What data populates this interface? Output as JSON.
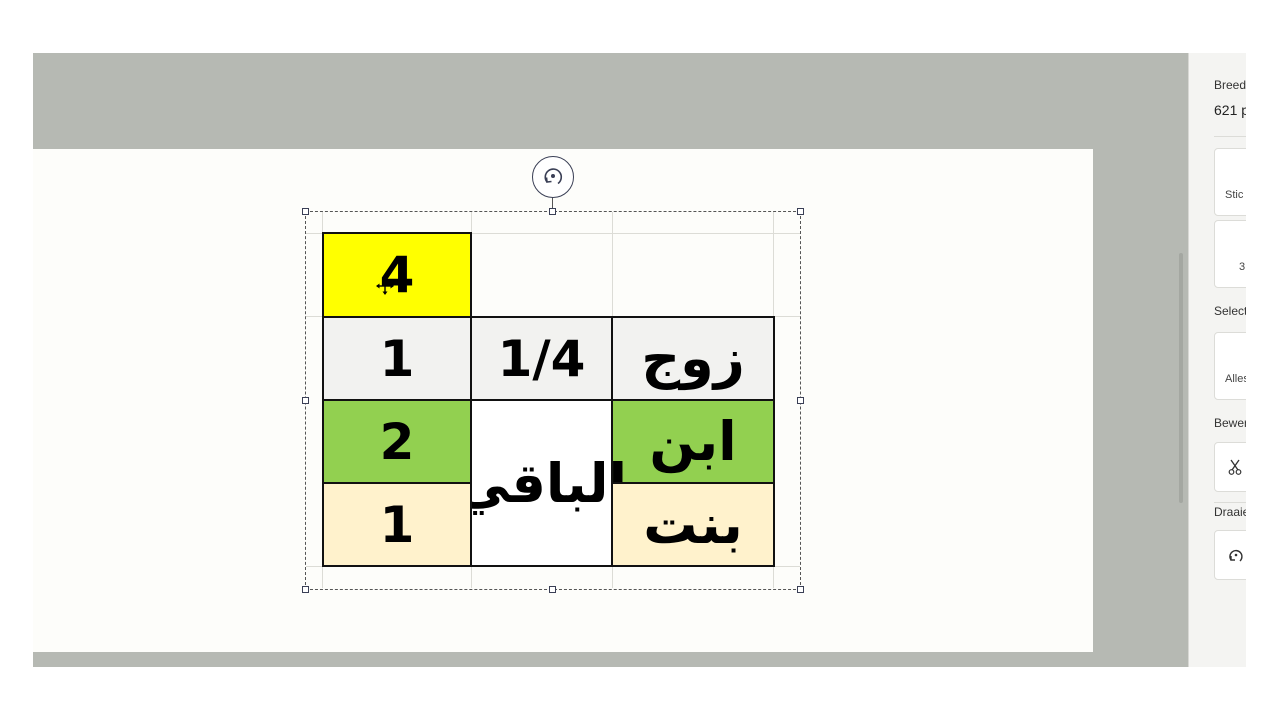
{
  "side_panel": {
    "width_label": "Breedt",
    "width_value": "621 p",
    "sticker_button": "Stic",
    "threed_button": "3",
    "selection_label": "Selecte",
    "select_all_button": "Alles",
    "edit_label": "Bewer",
    "cut_icon": "scissors-icon",
    "rotate_label": "Draaie",
    "rotate_icon": "rotate-icon"
  },
  "table": {
    "header_value": "4",
    "rows": [
      {
        "value": "1",
        "share": "1/4",
        "heir": "زوج",
        "color": "#f2f2f0"
      },
      {
        "value": "2",
        "share": "",
        "heir": "ابن",
        "color": "#92d050"
      },
      {
        "value": "1",
        "share": "",
        "heir": "بنت",
        "color": "#fff2cc"
      }
    ],
    "residue_label": "الباقي",
    "header_color": "#ffff00"
  },
  "colors": {
    "workspace_bg": "#b6b9b3",
    "canvas_bg": "#fdfdfa",
    "selection_border": "#555555"
  }
}
